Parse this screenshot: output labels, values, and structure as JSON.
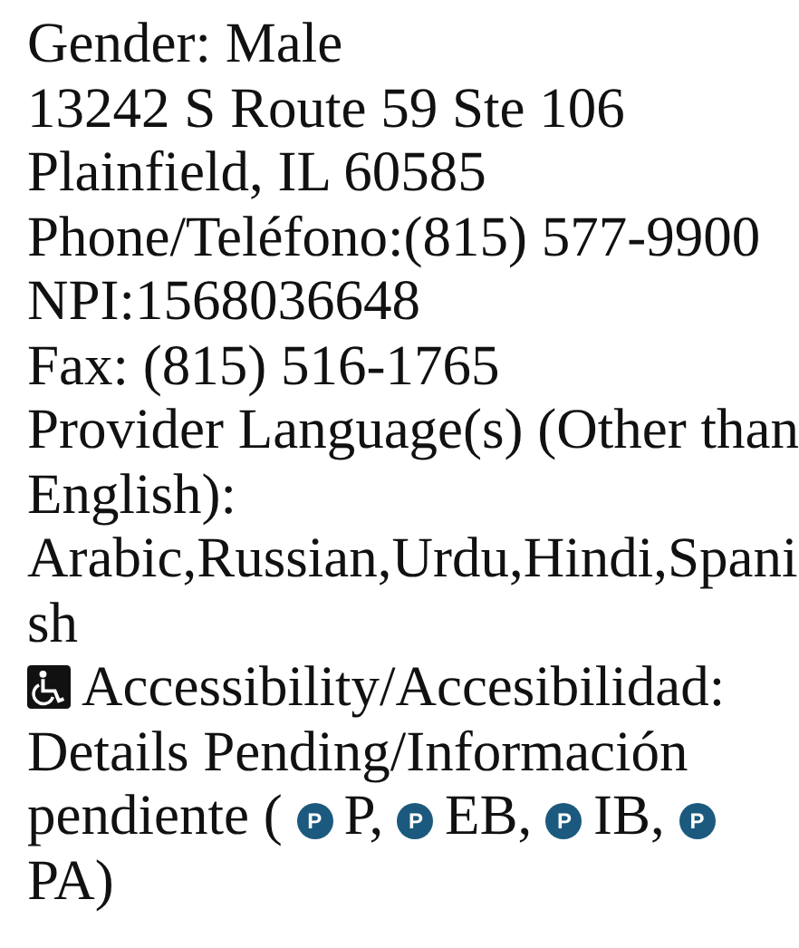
{
  "lines": [
    "Gender: Male",
    "13242 S Route 59 Ste 106",
    "Plainfield, IL 60585",
    "Phone/Teléfono:(815) 577-9900",
    "NPI:1568036648",
    "Fax: (815) 516-1765",
    "Provider Language(s) (Other than English):"
  ],
  "languages": "Arabic,Russian,Urdu,Hindi,Spanish",
  "accessibility": {
    "label": "Accessibility/Accesibilidad:",
    "details": "Details Pending/Información",
    "details_2": "pendiente (",
    "codes": [
      {
        "badge": "P",
        "code": "P,"
      },
      {
        "badge": "P",
        "code": "EB,"
      },
      {
        "badge": "P",
        "code": "IB,"
      },
      {
        "badge": "P",
        "code": "PA"
      }
    ],
    "close": ")"
  }
}
